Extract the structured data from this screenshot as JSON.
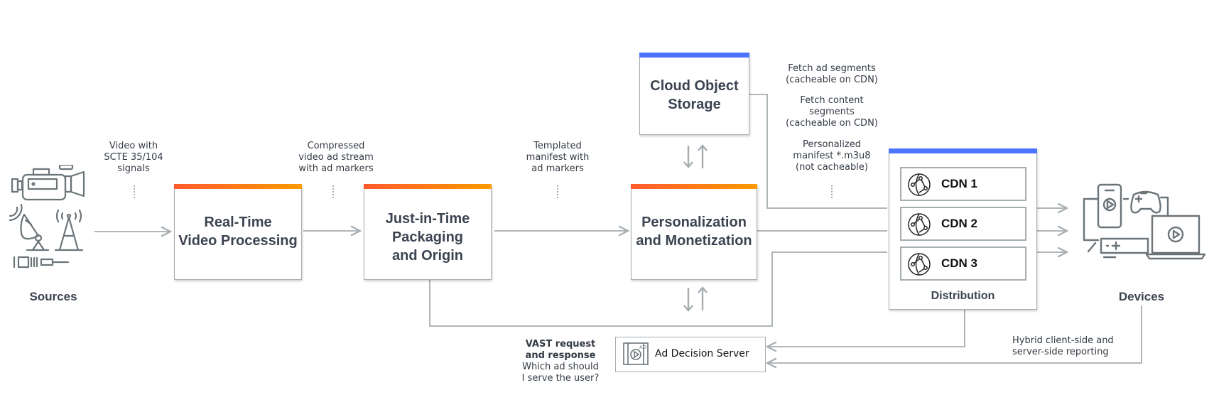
{
  "sources": {
    "label": "Sources",
    "icons": [
      "video-camera-icon",
      "satellite-dish-icon",
      "broadcast-tower-icon",
      "fiber-cable-icon"
    ]
  },
  "flow_labels": {
    "sources_to_rtvp": [
      "Video with",
      "SCTE 35/104",
      "signals"
    ],
    "rtvp_to_jit": [
      "Compressed",
      "video ad stream",
      "with ad markers"
    ],
    "jit_to_pm": [
      "Templated",
      "manifest with",
      "ad markers"
    ],
    "fetch_ad": [
      "Fetch ad segments",
      "(cacheable on CDN)"
    ],
    "fetch_content": [
      "Fetch content",
      "segments",
      "(cacheable on CDN)"
    ],
    "personalized_manifest": [
      "Personalized",
      "manifest *.m3u8",
      "(not cacheable)"
    ],
    "vast_bold": [
      "VAST request",
      "and response"
    ],
    "vast_normal": [
      "Which ad should",
      "I serve the user?"
    ],
    "reporting": [
      "Hybrid client-side and",
      "server-side reporting"
    ]
  },
  "nodes": {
    "rtvp": {
      "lines": [
        "Real-Time",
        "Video Processing"
      ],
      "accent": "orange"
    },
    "jit": {
      "lines": [
        "Just-in-Time",
        "Packaging",
        "and Origin"
      ],
      "accent": "orange"
    },
    "pm": {
      "lines": [
        "Personalization",
        "and Monetization"
      ],
      "accent": "orange"
    },
    "storage": {
      "lines": [
        "Cloud Object",
        "Storage"
      ],
      "accent": "blue"
    },
    "distribution": {
      "label": "Distribution",
      "accent": "blue",
      "cdns": [
        {
          "name": "CDN 1"
        },
        {
          "name": "CDN 2"
        },
        {
          "name": "CDN 3"
        }
      ]
    },
    "ads": {
      "label": "Ad Decision Server",
      "icon": "ad-video-icon"
    }
  },
  "devices": {
    "label": "Devices",
    "icons": [
      "smartphone-icon",
      "game-controller-icon",
      "laptop-icon",
      "set-top-box-icon",
      "tv-icon"
    ]
  },
  "colors": {
    "orange_start": "#ff5a2e",
    "orange_end": "#ff9a00",
    "blue": "#4c74ff",
    "line": "#a6adb0",
    "title_text": "#3c4452"
  }
}
